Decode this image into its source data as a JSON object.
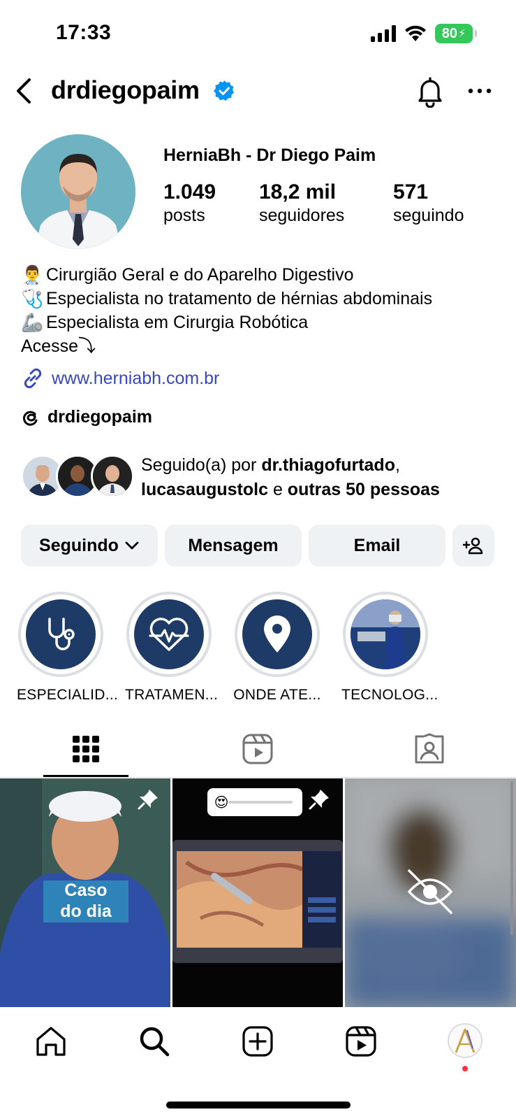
{
  "status_bar": {
    "time": "17:33",
    "battery": "80"
  },
  "header": {
    "username": "drdiegopaim"
  },
  "profile": {
    "display_name": "HerniaBh - Dr Diego Paim",
    "stats": [
      {
        "value": "1.049",
        "label": "posts"
      },
      {
        "value": "18,2 mil",
        "label": "seguidores"
      },
      {
        "value": "571",
        "label": "seguindo"
      }
    ]
  },
  "bio": {
    "lines": [
      {
        "emoji": "👨‍⚕️",
        "text": "Cirurgião Geral e do Aparelho Digestivo"
      },
      {
        "emoji": "🩺",
        "text": "Especialista no tratamento de hérnias abdominais"
      },
      {
        "emoji": "🦾",
        "text": "Especialista em Cirurgia Robótica"
      }
    ],
    "cta": "Acesse⤵",
    "link": "www.herniabh.com.br",
    "threads": "drdiegopaim"
  },
  "followed_by": {
    "prefix": "Seguido(a) por ",
    "user1": "dr.thiagofurtado",
    "sep": ",",
    "user2": "lucasaugustolc",
    "and": " e ",
    "others": "outras 50 pessoas"
  },
  "buttons": {
    "following": "Seguindo",
    "message": "Mensagem",
    "email": "Email"
  },
  "highlights": [
    {
      "label": "ESPECIALID...",
      "icon": "stethoscope-icon"
    },
    {
      "label": "TRATAMEN...",
      "icon": "heart-pulse-icon"
    },
    {
      "label": "ONDE ATE...",
      "icon": "location-pin-icon"
    },
    {
      "label": "TECNOLOG...",
      "icon": "surgery-photo"
    }
  ],
  "grid": {
    "post1_text_line1": "Caso",
    "post1_text_line2": "do dia",
    "post2_emoji": "😍"
  },
  "colors": {
    "verified": "#0095f6",
    "link": "#3847c2",
    "highlight_bg": "#1e3a66",
    "button_bg": "#eff2f5",
    "notification_dot": "#ff3040"
  }
}
